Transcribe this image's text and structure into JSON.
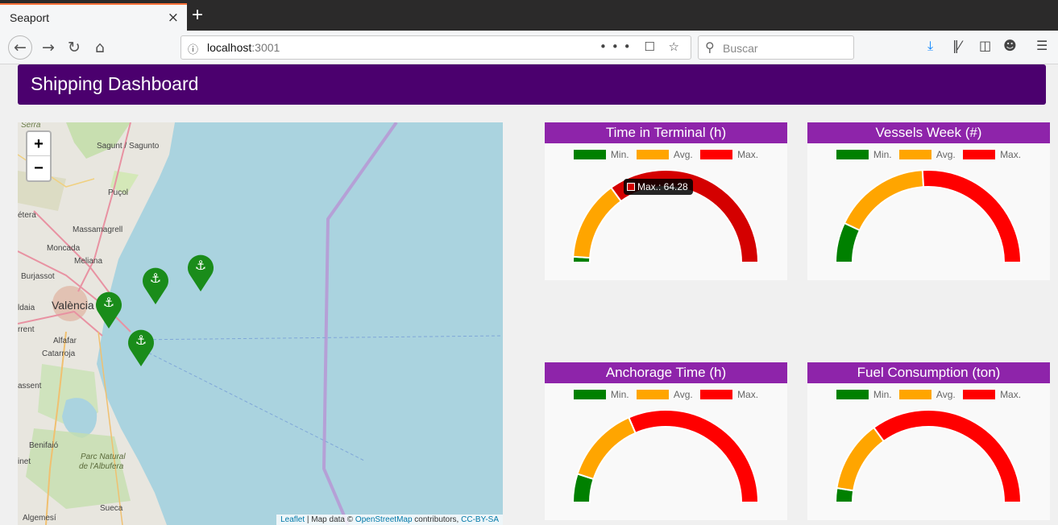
{
  "browser": {
    "tab_title": "Seaport",
    "tab_close": "×",
    "new_tab": "+",
    "url_host": "localhost",
    "url_port": ":3001",
    "url_actions": "••• ☐ ☆",
    "search_placeholder": "Buscar"
  },
  "page": {
    "title": "Shipping Dashboard"
  },
  "map": {
    "zoom_in": "+",
    "zoom_out": "−",
    "labels": [
      "Serra",
      "Sagunt / Sagunto",
      "Puçol",
      "étera",
      "Massamagrell",
      "Moncada",
      "Meliana",
      "Burjassot",
      "València",
      "ldaia",
      "rrent",
      "Alfafar",
      "Catarroja",
      "assent",
      "Benifaió",
      "Parc Natural",
      "de l'Albufera",
      "inet",
      "Sueca",
      "Algemesí"
    ],
    "attribution": {
      "leaflet": "Leaflet",
      "sep": " | Map data © ",
      "osm": "OpenStreetMap",
      "contrib": " contributors, ",
      "license": "CC-BY-SA"
    },
    "markers": [
      "anchor-icon",
      "anchor-icon",
      "anchor-icon",
      "anchor-icon"
    ]
  },
  "legend": {
    "min": "Min.",
    "avg": "Avg.",
    "max": "Max."
  },
  "colors": {
    "min": "#008000",
    "avg": "#ffa500",
    "max": "#ff0000",
    "header": "#4b006e",
    "panel_title": "#8e24aa"
  },
  "panels": [
    {
      "title": "Time in Terminal (h)",
      "min_pct": 0.02,
      "avg_pct": 0.3,
      "tooltip": "Max.: 64.28",
      "hover_max": true
    },
    {
      "title": "Vessels Week (#)",
      "min_pct": 0.14,
      "avg_pct": 0.48
    },
    {
      "title": "Anchorage Time (h)",
      "min_pct": 0.1,
      "avg_pct": 0.37
    },
    {
      "title": "Fuel Consumption (ton)",
      "min_pct": 0.05,
      "avg_pct": 0.3
    }
  ]
}
